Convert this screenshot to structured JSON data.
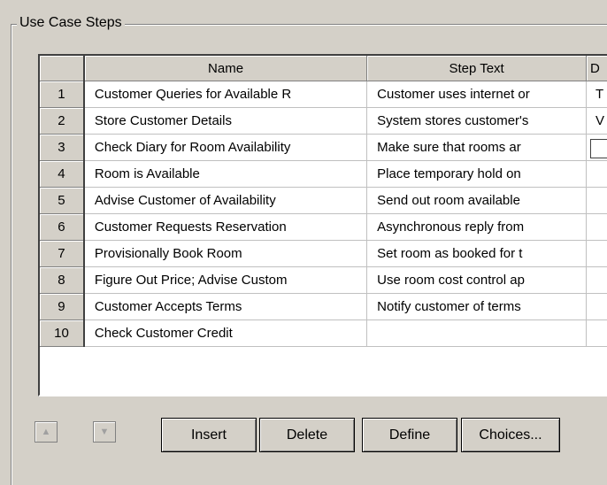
{
  "group": {
    "title": "Use Case Steps"
  },
  "grid": {
    "columns": [
      "Name",
      "Step Text",
      "D"
    ],
    "rows": [
      {
        "num": "1",
        "name": "Customer Queries for Available R",
        "step": "Customer uses internet or",
        "d": "T"
      },
      {
        "num": "2",
        "name": "Store Customer Details",
        "step": "System stores customer's",
        "d": "V"
      },
      {
        "num": "3",
        "name": "Check Diary for Room Availability",
        "step": "Make sure that rooms ar",
        "d": ""
      },
      {
        "num": "4",
        "name": "Room is Available",
        "step": "Place temporary hold on",
        "d": ""
      },
      {
        "num": "5",
        "name": "Advise Customer of Availability",
        "step": "Send out room available",
        "d": ""
      },
      {
        "num": "6",
        "name": "Customer Requests Reservation",
        "step": "Asynchronous reply from",
        "d": ""
      },
      {
        "num": "7",
        "name": "Provisionally Book Room",
        "step": "Set room as booked for t",
        "d": ""
      },
      {
        "num": "8",
        "name": "Figure Out Price; Advise Custom",
        "step": "Use room cost control ap",
        "d": ""
      },
      {
        "num": "9",
        "name": "Customer Accepts Terms",
        "step": "Notify customer of terms",
        "d": ""
      },
      {
        "num": "10",
        "name": "Check Customer Credit",
        "step": "",
        "d": ""
      }
    ]
  },
  "buttons": {
    "move_up_icon": "triangle-up",
    "move_down_icon": "triangle-down",
    "insert": "Insert",
    "delete": "Delete",
    "define": "Define",
    "choices": "Choices..."
  }
}
